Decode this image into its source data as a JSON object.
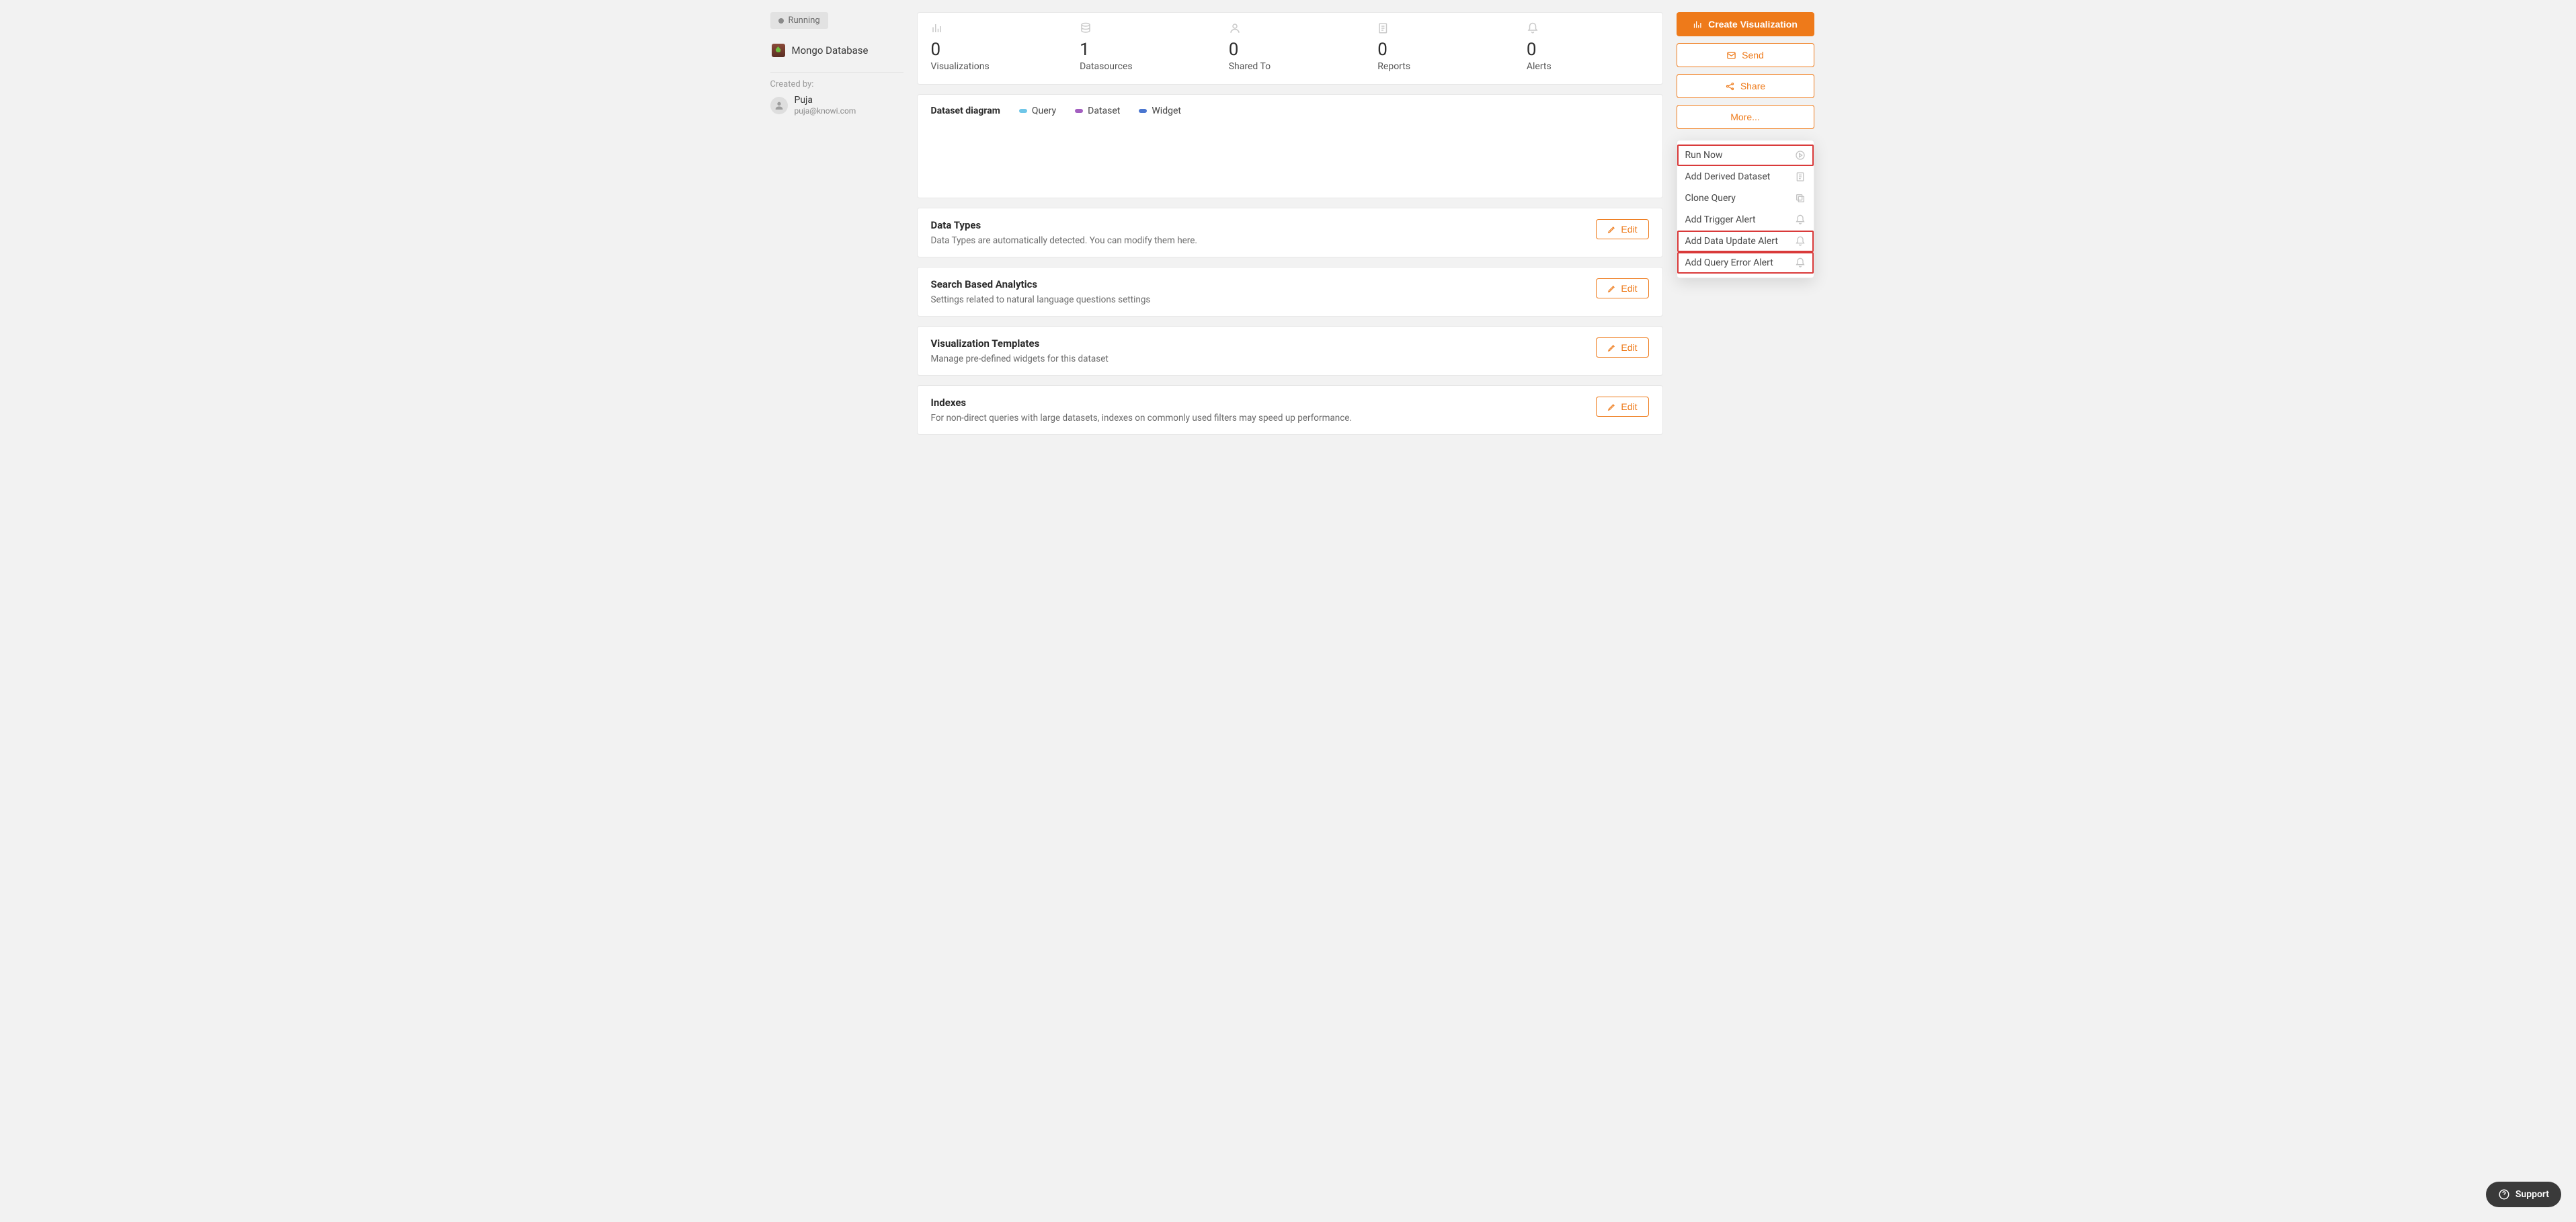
{
  "sidebar": {
    "status_label": "Running",
    "db_name": "Mongo Database",
    "created_by_label": "Created by:",
    "user_name": "Puja",
    "user_email": "puja@knowi.com"
  },
  "stats": [
    {
      "id": "visualizations",
      "value": "0",
      "label": "Visualizations"
    },
    {
      "id": "datasources",
      "value": "1",
      "label": "Datasources"
    },
    {
      "id": "shared-to",
      "value": "0",
      "label": "Shared To"
    },
    {
      "id": "reports",
      "value": "0",
      "label": "Reports"
    },
    {
      "id": "alerts",
      "value": "0",
      "label": "Alerts"
    }
  ],
  "diagram": {
    "title": "Dataset diagram",
    "legend": [
      {
        "label": "Query",
        "color": "#6fc6e8"
      },
      {
        "label": "Dataset",
        "color": "#a35fc0"
      },
      {
        "label": "Widget",
        "color": "#4a76d0"
      }
    ]
  },
  "sections": [
    {
      "id": "data-types",
      "title": "Data Types",
      "desc": "Data Types are automatically detected. You can modify them here.",
      "edit": "Edit"
    },
    {
      "id": "search-analytics",
      "title": "Search Based Analytics",
      "desc": "Settings related to natural language questions settings",
      "edit": "Edit"
    },
    {
      "id": "viz-templates",
      "title": "Visualization Templates",
      "desc": "Manage pre-defined widgets for this dataset",
      "edit": "Edit"
    },
    {
      "id": "indexes",
      "title": "Indexes",
      "desc": "For non-direct queries with large datasets, indexes on commonly used filters may speed up performance.",
      "edit": "Edit"
    }
  ],
  "actions": {
    "create_visualization": "Create Visualization",
    "send": "Send",
    "share": "Share",
    "more": "More..."
  },
  "more_menu": [
    {
      "id": "run-now",
      "label": "Run Now",
      "highlight": true
    },
    {
      "id": "add-derived",
      "label": "Add Derived Dataset",
      "highlight": false
    },
    {
      "id": "clone-query",
      "label": "Clone Query",
      "highlight": false
    },
    {
      "id": "add-trigger",
      "label": "Add Trigger Alert",
      "highlight": false
    },
    {
      "id": "add-data-update",
      "label": "Add Data Update Alert",
      "highlight": true
    },
    {
      "id": "add-query-error",
      "label": "Add Query Error Alert",
      "highlight": true
    }
  ],
  "support_label": "Support"
}
